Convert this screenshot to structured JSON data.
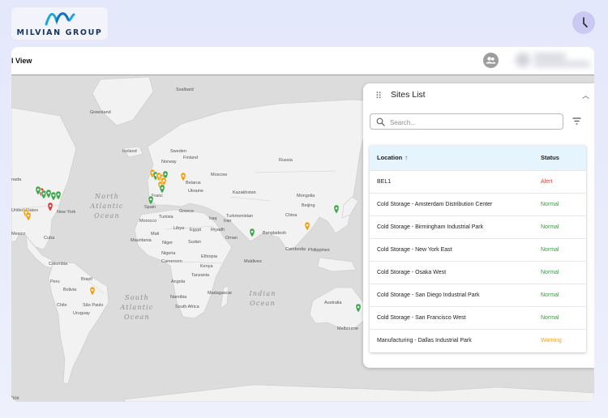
{
  "brand": {
    "name": "MILVIAN GROUP",
    "logo_color": "#1aa7d8"
  },
  "header": {
    "title": "l View",
    "user_icon": "people-icon"
  },
  "map": {
    "labels": {
      "greenland": "Greenland",
      "svalbard": "Svalbard",
      "iceland": "Iceland",
      "sweden": "Sweden",
      "finland": "Finland",
      "norway": "Norway",
      "russia": "Russia",
      "moscow": "Moscow",
      "belarus": "Belarus",
      "ukraine": "Ukraine",
      "kazakhstan": "Kazakhstan",
      "mongolia": "Mongolia",
      "turkmenistan": "Turkmenistan",
      "china": "China",
      "beijing": "Beijing",
      "iraq": "Iraq",
      "iran": "Iran",
      "riyadh": "Riyadh",
      "oman": "Oman",
      "egypt": "Egypt",
      "libya": "Libya",
      "tunisia": "Tunisia",
      "morocco": "Morocco",
      "mauritania": "Mauritania",
      "mali": "Mali",
      "niger": "Niger",
      "nigeria": "Nigeria",
      "sudan": "Sudan",
      "ethiopia": "Ethiopia",
      "kenya": "Kenya",
      "tanzania": "Tanzania",
      "cameroon": "Cameroon",
      "angola": "Angola",
      "namibia": "Namibia",
      "south_africa": "South Africa",
      "madagascar": "Madagascar",
      "greece": "Greece",
      "france": "Franc",
      "spain": "Spain",
      "bangladesh": "Bangladesh",
      "cambodia": "Cambodia",
      "philippines": "Philippines",
      "maldives": "Maldives",
      "australia": "Australia",
      "melbourne": "Melbourne",
      "canada": "nada",
      "united_states": "United States",
      "new_york": "New York",
      "mexico": "Mexico",
      "cuba": "Cuba",
      "colombia": "Colombia",
      "peru": "Peru",
      "brazil": "Brazil",
      "bolivia": "Bolivia",
      "chile": "Chile",
      "uruguay": "Uruguay",
      "sao_paulo": "São Paulo",
      "north_atlantic": "North Atlantic Ocean",
      "south_atlantic": "South Atlantic Ocean",
      "indian_ocean": "Indian Ocean",
      "attribution": "box"
    },
    "marker_colors": {
      "normal": "#3ea84a",
      "warning": "#f4a018",
      "alert": "#e53935"
    }
  },
  "sites_panel": {
    "title": "Sites List",
    "drag_icon": "drag-handle-icon",
    "collapse_icon": "chevron-up-icon",
    "search_placeholder": "Search...",
    "filter_icon": "filter-icon",
    "columns": {
      "location": "Location",
      "sort_icon": "↑",
      "status": "Status"
    },
    "rows": [
      {
        "name": "BEL1",
        "status": "Alert",
        "color": "#e53935"
      },
      {
        "name": "Cold Storage - Amsterdam Distribution Center",
        "status": "Normal",
        "color": "#2e9e3a"
      },
      {
        "name": "Cold Storage - Birmingham Industrial Park",
        "status": "Normal",
        "color": "#2e9e3a"
      },
      {
        "name": "Cold Storage - New York East",
        "status": "Normal",
        "color": "#2e9e3a"
      },
      {
        "name": "Cold Storage - Osaka West",
        "status": "Normal",
        "color": "#2e9e3a"
      },
      {
        "name": "Cold Storage - San Diego Industrial Park",
        "status": "Normal",
        "color": "#2e9e3a"
      },
      {
        "name": "Cold Storage - San Francisco West",
        "status": "Normal",
        "color": "#2e9e3a"
      },
      {
        "name": "Manufacturing - Dallas Industrial Park",
        "status": "Warning",
        "color": "#f4a018"
      }
    ]
  }
}
